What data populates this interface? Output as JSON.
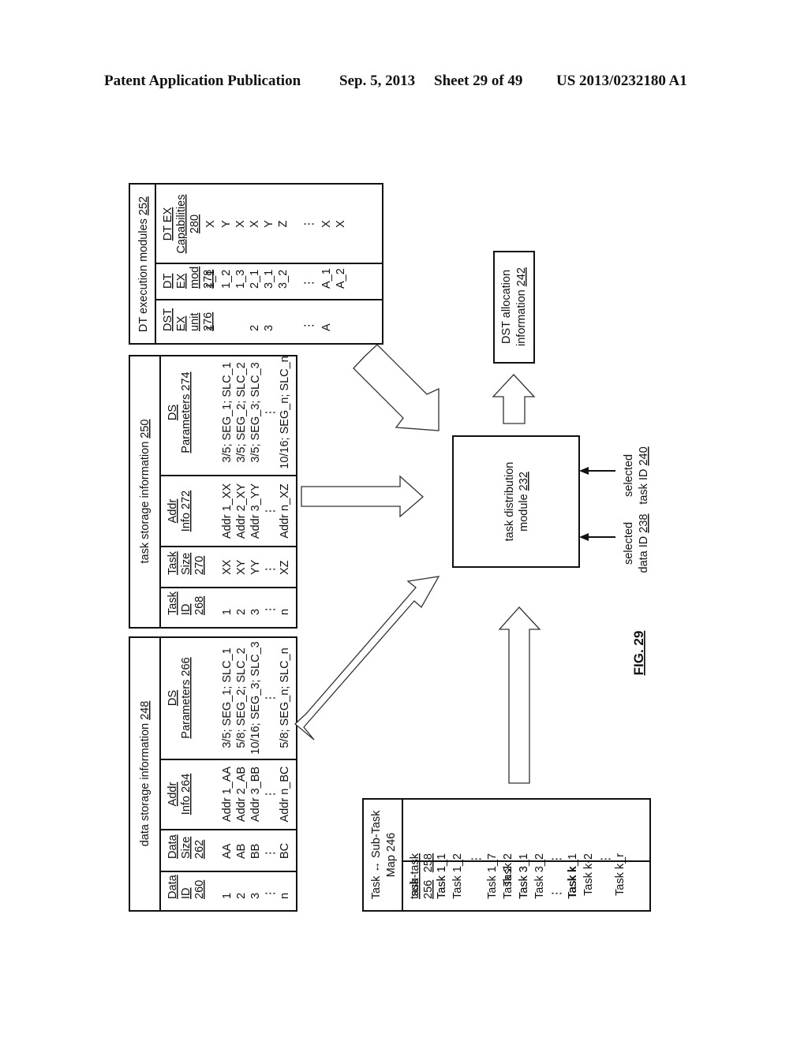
{
  "header": {
    "publication": "Patent Application Publication",
    "date": "Sep. 5, 2013",
    "sheet": "Sheet 29 of 49",
    "patent_number": "US 2013/0232180 A1"
  },
  "figure_label": "FIG. 29",
  "dt_execution_modules": {
    "title": "DT execution modules ",
    "title_ref": "252",
    "columns": [
      {
        "lines": [
          "DST",
          "EX",
          "unit",
          "276"
        ]
      },
      {
        "lines": [
          "DT",
          "EX",
          "mod",
          "278"
        ]
      },
      {
        "lines": [
          "DT EX",
          "Capabilities",
          "280"
        ]
      }
    ],
    "rows": [
      [
        "1",
        "1_1",
        "X"
      ],
      [
        "",
        "1_2",
        "Y"
      ],
      [
        "",
        "1_3",
        "X"
      ],
      [
        "2",
        "2_1",
        "X"
      ],
      [
        "3",
        "3_1",
        "Y"
      ],
      [
        "",
        "3_2",
        "Z"
      ],
      [
        "⋮",
        "⋮",
        "⋮"
      ],
      [
        "A",
        "A_1",
        "X"
      ],
      [
        "",
        "A_2",
        "X"
      ]
    ]
  },
  "task_storage_information": {
    "title": "task storage information ",
    "title_ref": "250",
    "columns": [
      {
        "lines": [
          "Task",
          "ID",
          "268"
        ]
      },
      {
        "lines": [
          "Task",
          "Size",
          "270"
        ]
      },
      {
        "lines": [
          "Addr",
          "Info 272"
        ]
      },
      {
        "lines": [
          "DS",
          "Parameters 274"
        ]
      }
    ],
    "rows": [
      [
        "1",
        "XX",
        "Addr 1_XX",
        "3/5; SEG_1; SLC_1"
      ],
      [
        "2",
        "XY",
        "Addr 2_XY",
        "3/5; SEG_2; SLC_2"
      ],
      [
        "3",
        "YY",
        "Addr 3_YY",
        "3/5; SEG_3; SLC_3"
      ],
      [
        "⋮",
        "⋮",
        "⋮",
        "⋮"
      ],
      [
        "n",
        "XZ",
        "Addr n_XZ",
        "10/16; SEG_n; SLC_n"
      ]
    ]
  },
  "data_storage_information": {
    "title": "data storage information ",
    "title_ref": "248",
    "columns": [
      {
        "lines": [
          "Data",
          "ID",
          "260"
        ]
      },
      {
        "lines": [
          "Data",
          "Size",
          "262"
        ]
      },
      {
        "lines": [
          "Addr",
          "Info 264"
        ]
      },
      {
        "lines": [
          "DS",
          "Parameters 266"
        ]
      }
    ],
    "rows": [
      [
        "1",
        "AA",
        "Addr 1_AA",
        "3/5; SEG_1; SLC_1"
      ],
      [
        "2",
        "AB",
        "Addr 2_AB",
        "5/8; SEG_2; SLC_2"
      ],
      [
        "3",
        "BB",
        "Addr 3_BB",
        "10/16; SEG_3; SLC_3"
      ],
      [
        "⋮",
        "⋮",
        "⋮",
        "⋮"
      ],
      [
        "n",
        "BC",
        "Addr n_BC",
        "5/8; SEG_n; SLC_n"
      ]
    ]
  },
  "task_subtask_map": {
    "title_line1": "Task ↔ Sub-Task",
    "title_line2": "Map 246",
    "columns": [
      {
        "lines": [
          "task",
          "256"
        ]
      },
      {
        "lines": [
          "sub-task",
          "258"
        ]
      }
    ],
    "rows": [
      [
        "Task 1",
        "Task 1_1"
      ],
      [
        "",
        "Task 1_2"
      ],
      [
        "",
        "⋮"
      ],
      [
        "",
        "Task 1_7"
      ],
      [
        "Task 2",
        "Task 2"
      ],
      [
        "Task 3",
        "Task 3_1"
      ],
      [
        "",
        "Task 3_2"
      ],
      [
        "⋮",
        "⋮"
      ],
      [
        "Task k",
        "Task k_1"
      ],
      [
        "",
        "Task k-2"
      ],
      [
        "",
        "⋮"
      ],
      [
        "",
        "Task k_r"
      ]
    ]
  },
  "task_distribution_module": {
    "line1": "task distribution",
    "line2": "module ",
    "ref": "232"
  },
  "dst_allocation_information": {
    "line1": "DST allocation",
    "line2": "information ",
    "ref": "242"
  },
  "inputs": {
    "selected_data_id": {
      "line1": "selected",
      "line2": "data ID ",
      "ref": "238"
    },
    "selected_task_id": {
      "line1": "selected",
      "line2": "task ID ",
      "ref": "240"
    }
  }
}
